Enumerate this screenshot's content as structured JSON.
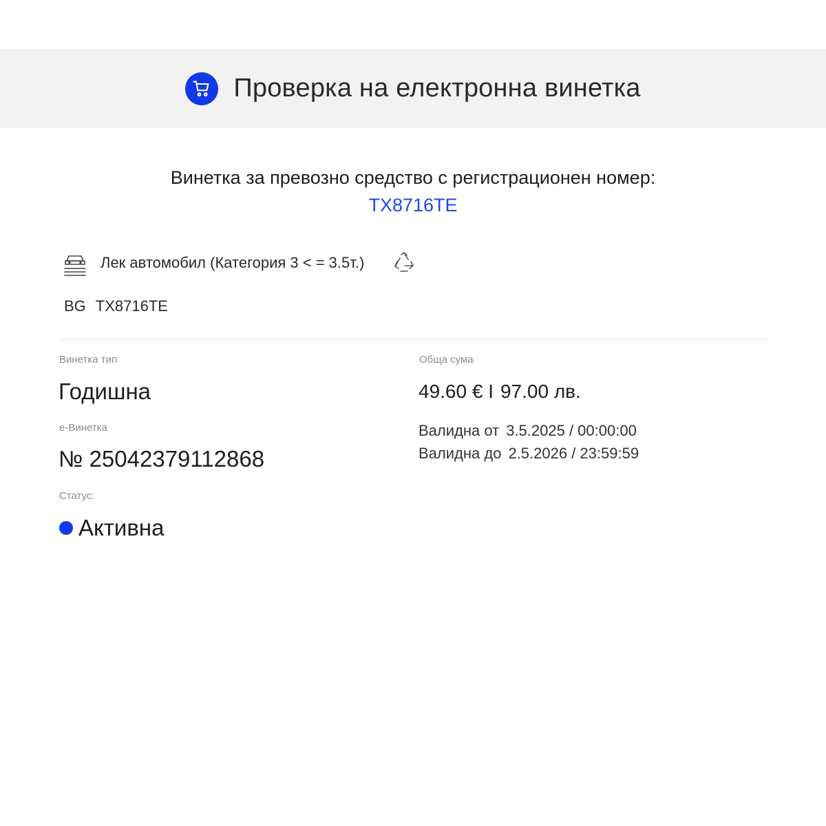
{
  "header": {
    "title": "Проверка на електронна винетка",
    "icon": "cart-icon",
    "accent": "#1239e8"
  },
  "summary": {
    "subtitle": "Винетка за превозно средство с регистрационен номер:",
    "plate": "TX8716TE",
    "link_color": "#1f49e6"
  },
  "vehicle": {
    "icon": "car-icon",
    "category": "Лек автомобил (Категория 3 < = 3.5т.)",
    "eco_icon": "recycle-icon",
    "country": "BG",
    "plate": "TX8716TE"
  },
  "details": {
    "type_label": "Винетка тип",
    "type_value": "Годишна",
    "evignette_label": "е-Винетка",
    "evignette_value": "№ 25042379112868",
    "status_label": "Статус:",
    "status_value": "Активна",
    "status_color": "#1239e8",
    "total_label": "Обща сума",
    "price_eur": "49.60 € I",
    "price_bgn": "97.00 лв.",
    "valid_from_label": "Валидна от",
    "valid_from_value": "3.5.2025 / 00:00:00",
    "valid_to_label": "Валидна до",
    "valid_to_value": "2.5.2026 / 23:59:59"
  }
}
